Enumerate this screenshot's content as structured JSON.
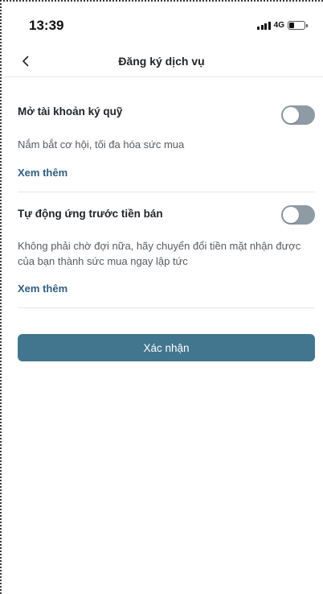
{
  "status_bar": {
    "time": "13:39",
    "network": "4G",
    "signal_icon": "signal-bars-icon",
    "battery_icon": "battery-icon",
    "battery_level": 0.35
  },
  "header": {
    "back_icon": "chevron-left-icon",
    "title": "Đăng ký dịch vụ"
  },
  "services": [
    {
      "title": "Mở tài khoản ký quỹ",
      "description": "Nắm bắt cơ hội, tối đa hóa sức mua",
      "see_more": "Xem thêm",
      "enabled": false
    },
    {
      "title": "Tự động ứng trước tiền bán",
      "description": "Không phải chờ đợi nữa, hãy chuyển đổi tiền mặt nhận được của bạn thành sức mua ngay lập tức",
      "see_more": "Xem thêm",
      "enabled": false
    }
  ],
  "confirm_label": "Xác nhận",
  "colors": {
    "accent": "#42768f",
    "link": "#2e5f7f",
    "toggle_off": "#8e9aa4"
  }
}
